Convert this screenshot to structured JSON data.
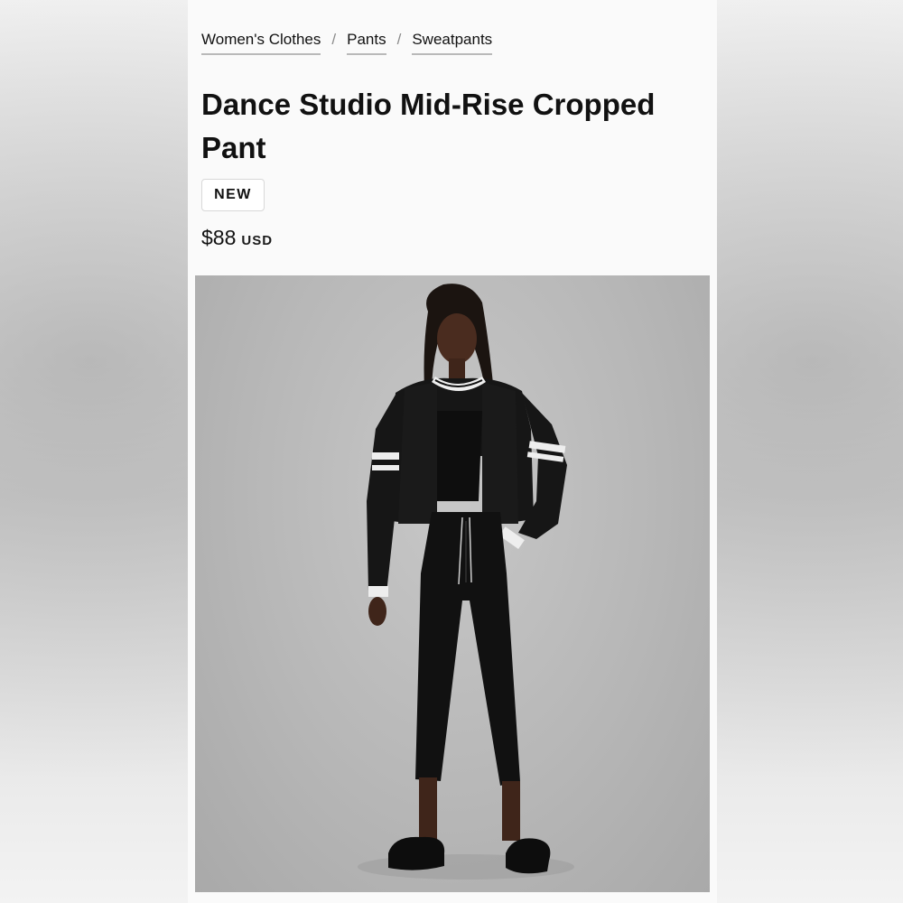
{
  "breadcrumb": {
    "items": [
      "Women's Clothes",
      "Pants",
      "Sweatpants"
    ],
    "separator": "/"
  },
  "product": {
    "title": "Dance Studio Mid-Rise Cropped Pant",
    "badge": "NEW",
    "price": "$88",
    "currency": "USD"
  },
  "colors": {
    "text": "#111111",
    "background": "#fafafa",
    "photo_background": "#b8b8b8",
    "garment": "#141414"
  }
}
